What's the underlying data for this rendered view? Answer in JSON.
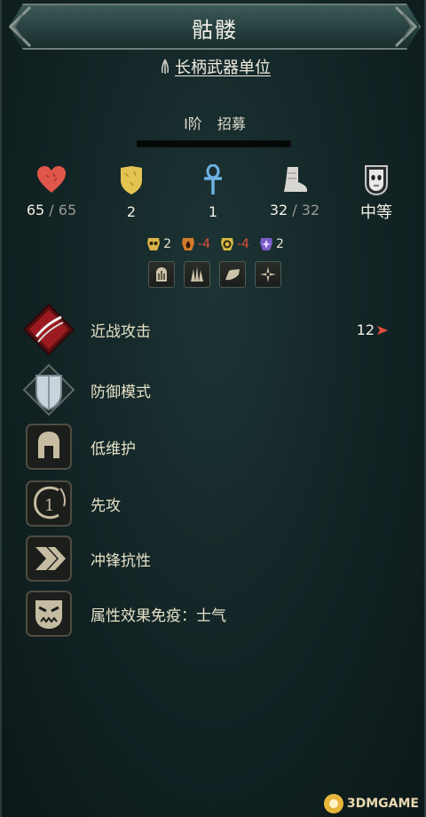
{
  "unit": {
    "name": "骷髅",
    "type_label": "长柄武器单位",
    "tier": "I阶",
    "recruit_label": "招募"
  },
  "stats": {
    "hp_current": "65",
    "hp_max": "/ 65",
    "defense": "2",
    "resistance": "1",
    "moves_current": "32",
    "moves_max": "/ 32",
    "upkeep": "中等"
  },
  "modifiers": [
    {
      "icon": "skull-damage-icon",
      "value": "2",
      "color": "#e8e4d0"
    },
    {
      "icon": "fire-damage-icon",
      "value": "-4",
      "color": "#e2503b"
    },
    {
      "icon": "frost-damage-icon",
      "value": "-4",
      "color": "#e2503b"
    },
    {
      "icon": "spirit-damage-icon",
      "value": "2",
      "color": "#e8e4d0"
    }
  ],
  "weapon_icons": [
    "blight-icon",
    "spikes-icon",
    "boot-icon",
    "star-icon"
  ],
  "abilities": [
    {
      "name": "近战攻击",
      "icon": "slash-icon",
      "extra": "12"
    },
    {
      "name": "防御模式",
      "icon": "shield-icon"
    },
    {
      "name": "低维护",
      "icon": "helmet-icon"
    },
    {
      "name": "先攻",
      "icon": "initiative-icon"
    },
    {
      "name": "冲锋抗性",
      "icon": "charge-icon"
    },
    {
      "name": "属性效果免疫：士气",
      "icon": "morale-icon"
    }
  ],
  "watermark": "3DMGAME"
}
